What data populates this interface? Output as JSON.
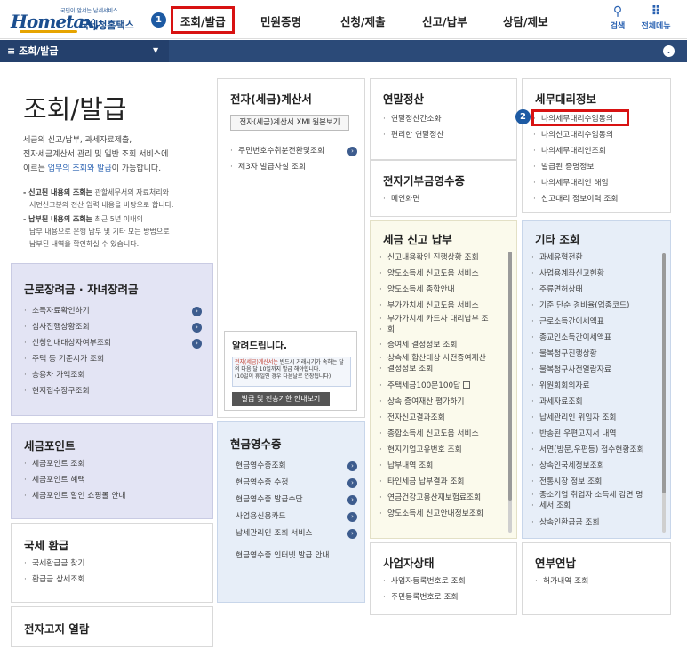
{
  "header": {
    "logo_small": "국민이 앞서는 납세서비스",
    "logo_main": "Hometax,",
    "logo_agency": "국세청홈택스",
    "step1": "1",
    "nav": [
      "조회/발급",
      "민원증명",
      "신청/제출",
      "신고/납부",
      "상담/제보"
    ],
    "search_label": "검색",
    "menu_label": "전체메뉴"
  },
  "subbar": {
    "label": "≡  조회/발급"
  },
  "hero": {
    "title": "조회/발급",
    "lines": [
      "세금의 신고/납부, 과세자료제출,",
      "전자세금계산서 관리 및 일반 조회 서비스에"
    ],
    "line3_a": "이르는 ",
    "line3_hl": "업무의 조회와 발급",
    "line3_b": "이 가능합니다.",
    "note1_bold": "- 신고된 내용의 조회는",
    "note1_a": " 관할세무서의 자료처리와",
    "note1_b": "서면신고분의 전산 입력 내용을 바탕으로 합니다.",
    "note2_bold": "- 납부된 내용의 조회는",
    "note2_a": " 최근 5년 이내의",
    "note2_b": "납부 내용으로 은행 납부 및 기타 모든 방법으로",
    "note2_c": "납부된 내역을 확인하실 수 있습니다."
  },
  "panels": {
    "ecin": {
      "title": "전자(세금)계산서",
      "button": "전자(세금)계산서 XML원본보기",
      "items": [
        "주민번호수취분전환및조회",
        "제3자 발급사실 조회"
      ]
    },
    "alert": {
      "title": "알려드립니다.",
      "text_red": "전자(세금)계산서는",
      "text_a": " 반드시 거래시기가 속하는 달의 다음 달 10일까지 발급 해야합니다.",
      "text_b": "(10일이 휴일인 경우 다음날로 연장됩니다)",
      "button": "발급 및 전송기한 안내보기"
    },
    "year": {
      "title": "연말정산",
      "items": [
        "연말정산간소화",
        "편리한 연말정산"
      ]
    },
    "donation": {
      "title": "전자기부금영수증",
      "items": [
        "메인화면"
      ]
    },
    "tax_agent": {
      "title": "세무대리정보",
      "step2": "2",
      "items": [
        "나의세무대리수임동의",
        "나의신고대리수임동의",
        "나의세무대리인조회",
        "발급된 증명정보",
        "나의세무대리인 해임",
        "신고대리 정보이력 조회"
      ]
    },
    "earned": {
      "title": "근로장려금 · 자녀장려금",
      "items": [
        "소득자료확인하기",
        "심사진행상황조회",
        "신청안내대상자여부조회",
        "주택 등 기준시가 조회",
        "승용차 가액조회",
        "현지접수장구조회"
      ]
    },
    "report": {
      "title": "세금 신고 납부",
      "items": [
        "신고내용확인 진행상황 조회",
        "양도소득세 신고도움 서비스",
        "양도소득세 종합안내",
        "부가가치세 신고도움 서비스",
        "부가가치세 카드사 대리납부 조",
        "회",
        "증여세 결정정보 조회",
        "상속세 합산대상 사전증여재산",
        "결정정보 조회",
        "주택세금100문100답",
        "상속 증여재산 평가하기",
        "전자신고결과조회",
        "종합소득세 신고도움 서비스",
        "현지기업고유번호 조회",
        "납부내역 조회",
        "타인세금 납부결과 조회",
        "연금건강고용산재보험료조회",
        "양도소득세 신고안내정보조회"
      ]
    },
    "other": {
      "title": "기타 조회",
      "items": [
        "과세유형전환",
        "사업용계좌신고현황",
        "주류면허상태",
        "기준·단순 경비율(업종코드)",
        "근로소득간이세액표",
        "종교인소득간이세액표",
        "불복청구진행상황",
        "불복청구사전열람자료",
        "위원회회의자료",
        "과세자료조회",
        "납세관리인 위임자 조회",
        "반송된 우편고지서 내역",
        "서면(방문,우편등) 접수현황조회",
        "상속인국세정보조회",
        "전통시장 정보 조회",
        "중소기업 취업자 소득세 감면 명",
        "세서 조회",
        "상속인환급금 조회"
      ]
    },
    "point": {
      "title": "세금포인트",
      "items": [
        "세금포인트 조회",
        "세금포인트 혜택",
        "세금포인트 할인 쇼핑몰 안내"
      ]
    },
    "cash": {
      "title": "현금영수증",
      "items": [
        "현금영수증조회",
        "현금영수증 수정",
        "현금영수증 발급수단",
        "사업용신용카드",
        "납세관리인 조회 서비스",
        "현금영수증 인터넷 발급 안내"
      ]
    },
    "refund": {
      "title": "국세 환급",
      "items": [
        "국세환급금 찾기",
        "환급금 상세조회"
      ]
    },
    "bill": {
      "title": "전자고지 열람"
    },
    "biz": {
      "title": "사업자상태",
      "items": [
        "사업자등록번호로 조회",
        "주민등록번호로 조회"
      ]
    },
    "annual": {
      "title": "연부연납",
      "items": [
        "허가내역 조회"
      ]
    }
  }
}
